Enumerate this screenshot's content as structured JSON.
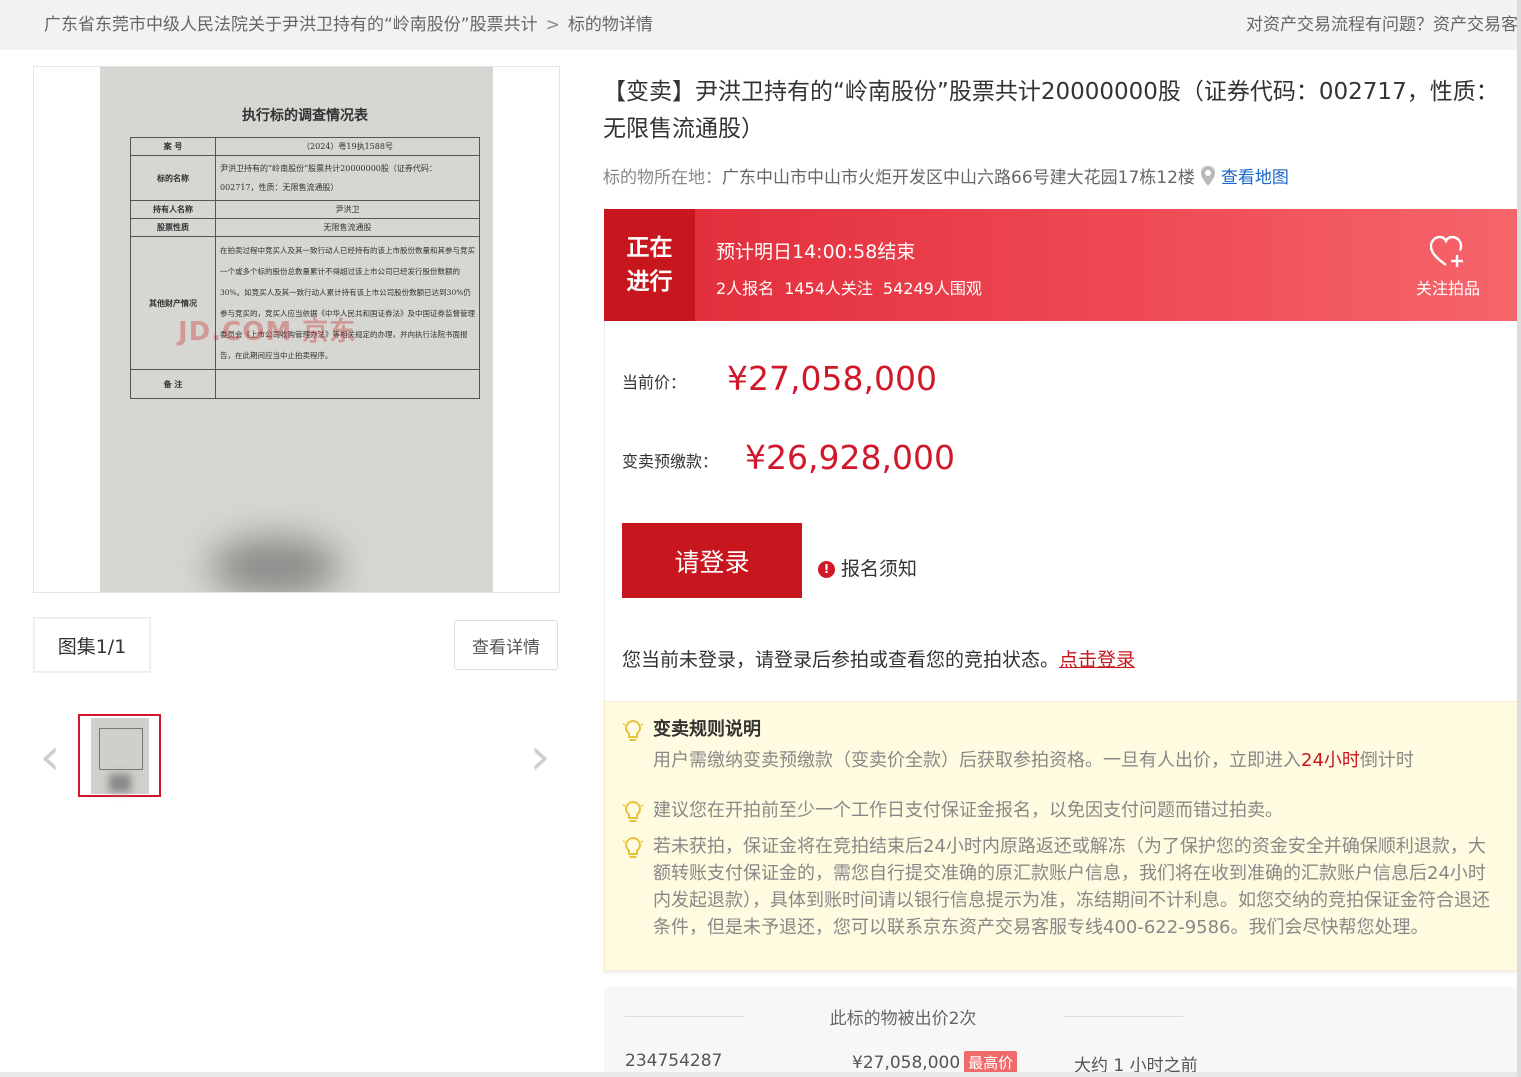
{
  "breadcrumb": {
    "parent": "广东省东莞市中级人民法院关于尹洪卫持有的“岭南股份”股票共计",
    "separator": ">",
    "current": "标的物详情"
  },
  "help_text": "对资产交易流程有问题？资产交易客",
  "document": {
    "title": "执行标的调查情况表",
    "rows": [
      {
        "k": "案 号",
        "v": "（2024）粤19执1588号"
      },
      {
        "k": "标的名称",
        "v": "尹洪卫持有的“岭南股份”股票共计20000000股（证券代码：002717，性质：无限售流通股）"
      },
      {
        "k": "持有人名称",
        "v": "尹洪卫"
      },
      {
        "k": "股票性质",
        "v": "无限售流通股"
      },
      {
        "k": "其他财产情况",
        "v": "在拍卖过程中竞买人及其一致行动人已经持有的该上市股份数量和其参与竞买一个或多个标的股份总数量累计不得超过该上市公司已经发行股份数额的30%。如竞买人及其一致行动人累计持有该上市公司股份数额已达到30%仍参与竞买的，竞买人应当依据《中华人民共和国证券法》及中国证券监督管理委员会《上市公司收购管理办法》等相关规定的办理，并向执行法院书面报告，在此期间应当中止拍卖程序。"
      },
      {
        "k": "备 注",
        "v": ""
      }
    ],
    "watermark": "JD.COM 京东"
  },
  "gallery": {
    "count": "图集1/1",
    "detail_button": "查看详情",
    "prev": "‹",
    "next": "›"
  },
  "item": {
    "title": "【变卖】尹洪卫持有的“岭南股份”股票共计20000000股（证券代码：002717，性质：无限售流通股）",
    "location_label": "标的物所在地：",
    "location": "广东中山市中山市火炬开发区中山六路66号建大花园17栋12楼",
    "map_link": "查看地图"
  },
  "auction": {
    "status_line1": "正在",
    "status_line2": "进行",
    "end_time": "预计明日14:00:58结束",
    "signups": "2人报名",
    "followers": "1454人关注",
    "views": "54249人围观",
    "follow_label": "关注拍品",
    "current_price_label": "当前价：",
    "current_price": "¥27,058,000",
    "deposit_label": "变卖预缴款：",
    "deposit": "¥26,928,000",
    "login_button": "请登录",
    "notice_icon": "!",
    "notice_label": "报名须知",
    "login_hint": "您当前未登录，请登录后参拍或查看您的竞拍状态。",
    "login_link": "点击登录"
  },
  "rules": {
    "title": "变卖规则说明",
    "rule1_pre": "用户需缴纳变卖预缴款（变卖价全款）后获取参拍资格。一旦有人出价，立即进入",
    "rule1_hl": "24小时",
    "rule1_post": "倒计时",
    "rule2": "建议您在开拍前至少一个工作日支付保证金报名，以免因支付问题而错过拍卖。",
    "rule3": "若未获拍，保证金将在竞拍结束后24小时内原路返还或解冻（为了保护您的资金安全并确保顺利退款，大额转账支付保证金的，需您自行提交准确的原汇款账户信息，我们将在收到准确的汇款账户信息后24小时内发起退款），具体到账时间请以银行信息提示为准，冻结期间不计利息。如您交纳的竞拍保证金符合退还条件，但是未予退还，您可以联系京东资产交易客服专线400-622-9586。我们会尽快帮您处理。"
  },
  "bids": {
    "caption": "此标的物被出价2次",
    "rows": [
      {
        "bidder": "234754287",
        "amount": "¥27,058,000",
        "badge": "最高价",
        "time": "大约 1 小时之前"
      }
    ]
  },
  "colors": {
    "brand_red": "#c8161e",
    "price_red": "#d0182a",
    "link_blue": "#1a66c7",
    "rules_bg": "#fffbe0"
  }
}
